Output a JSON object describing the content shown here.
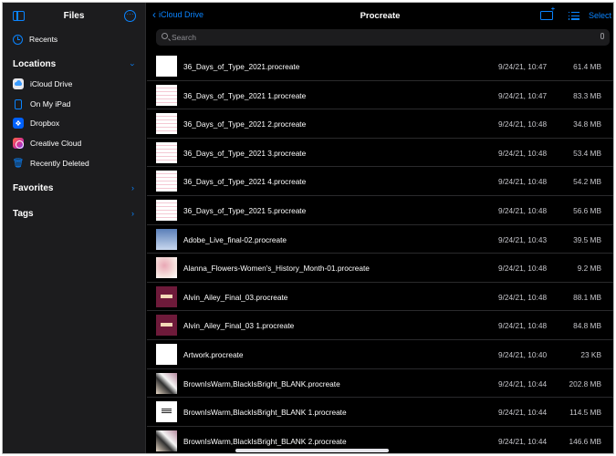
{
  "sidebar": {
    "title": "Files",
    "recents_label": "Recents",
    "locations_label": "Locations",
    "locations": [
      {
        "label": "iCloud Drive",
        "icon": "icloud-icon"
      },
      {
        "label": "On My iPad",
        "icon": "ipad-icon"
      },
      {
        "label": "Dropbox",
        "icon": "dropbox-icon"
      },
      {
        "label": "Creative Cloud",
        "icon": "creative-cloud-icon"
      },
      {
        "label": "Recently Deleted",
        "icon": "trash-icon"
      }
    ],
    "favorites_label": "Favorites",
    "tags_label": "Tags"
  },
  "header": {
    "back_label": "iCloud Drive",
    "title": "Procreate",
    "select_label": "Select"
  },
  "search": {
    "placeholder": "Search",
    "value": ""
  },
  "files": [
    {
      "name": "36_Days_of_Type_2021.procreate",
      "date": "9/24/21, 10:47",
      "size": "61.4 MB",
      "thumb": "white"
    },
    {
      "name": "36_Days_of_Type_2021 1.procreate",
      "date": "9/24/21, 10:47",
      "size": "83.3 MB",
      "thumb": "pinklines"
    },
    {
      "name": "36_Days_of_Type_2021 2.procreate",
      "date": "9/24/21, 10:48",
      "size": "34.8 MB",
      "thumb": "pinklines"
    },
    {
      "name": "36_Days_of_Type_2021 3.procreate",
      "date": "9/24/21, 10:48",
      "size": "53.4 MB",
      "thumb": "pinklines"
    },
    {
      "name": "36_Days_of_Type_2021 4.procreate",
      "date": "9/24/21, 10:48",
      "size": "54.2 MB",
      "thumb": "pinklines"
    },
    {
      "name": "36_Days_of_Type_2021 5.procreate",
      "date": "9/24/21, 10:48",
      "size": "56.6 MB",
      "thumb": "pinklines"
    },
    {
      "name": "Adobe_Live_final-02.procreate",
      "date": "9/24/21, 10:43",
      "size": "39.5 MB",
      "thumb": "blue"
    },
    {
      "name": "Alanna_Flowers-Women's_History_Month-01.procreate",
      "date": "9/24/21, 10:48",
      "size": "9.2 MB",
      "thumb": "flowers"
    },
    {
      "name": "Alvin_Ailey_Final_03.procreate",
      "date": "9/24/21, 10:48",
      "size": "88.1 MB",
      "thumb": "maroon"
    },
    {
      "name": "Alvin_Ailey_Final_03 1.procreate",
      "date": "9/24/21, 10:48",
      "size": "84.8 MB",
      "thumb": "maroon"
    },
    {
      "name": "Artwork.procreate",
      "date": "9/24/21, 10:40",
      "size": "23 KB",
      "thumb": "white"
    },
    {
      "name": "BrownIsWarm,BlackIsBright_BLANK.procreate",
      "date": "9/24/21, 10:44",
      "size": "202.8 MB",
      "thumb": "collage"
    },
    {
      "name": "BrownIsWarm,BlackIsBright_BLANK 1.procreate",
      "date": "9/24/21, 10:44",
      "size": "114.5 MB",
      "thumb": "textwhite"
    },
    {
      "name": "BrownIsWarm,BlackIsBright_BLANK 2.procreate",
      "date": "9/24/21, 10:44",
      "size": "146.6 MB",
      "thumb": "collage"
    }
  ]
}
